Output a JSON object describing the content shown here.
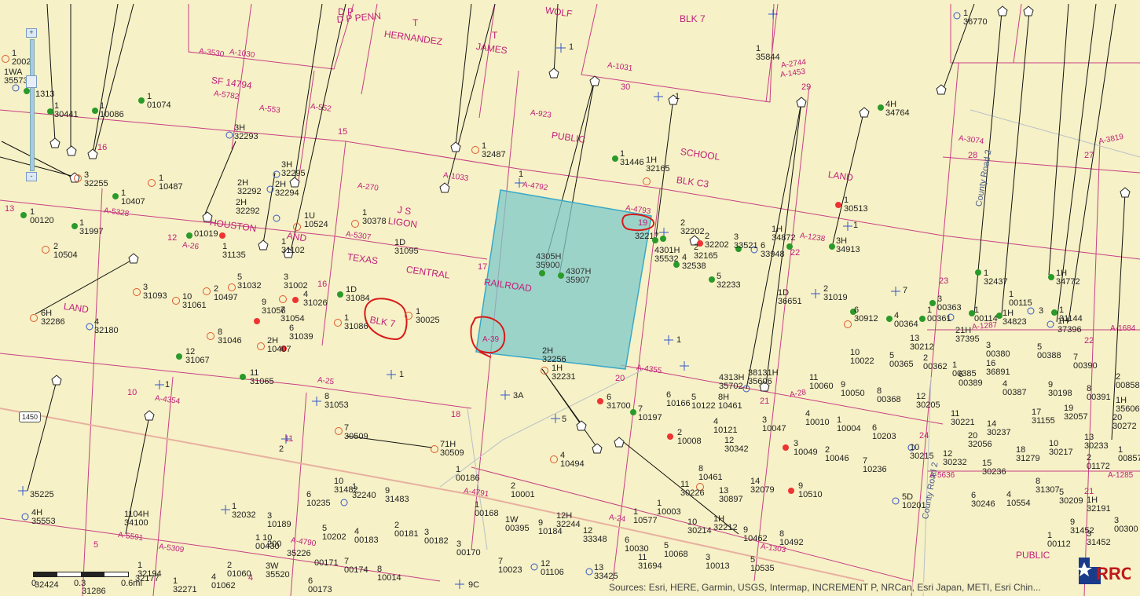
{
  "surveys": [
    {
      "id": "penn",
      "text": "D P\nPENN"
    },
    {
      "id": "hernandez",
      "text": "T\nHERNANDEZ"
    },
    {
      "id": "james",
      "text": "T\nJAMES"
    },
    {
      "id": "wolf",
      "text": "WOLF"
    },
    {
      "id": "blk7top",
      "text": "BLK 7"
    },
    {
      "id": "public1",
      "text": "PUBLIC"
    },
    {
      "id": "school",
      "text": "SCHOOL"
    },
    {
      "id": "blkc3",
      "text": "BLK C3"
    },
    {
      "id": "land1",
      "text": "LAND"
    },
    {
      "id": "houston",
      "text": "HOUSTON"
    },
    {
      "id": "and",
      "text": "AND"
    },
    {
      "id": "texas",
      "text": "TEXAS"
    },
    {
      "id": "central",
      "text": "CENTRAL"
    },
    {
      "id": "railroad",
      "text": "RAILROAD"
    },
    {
      "id": "js",
      "text": "J S"
    },
    {
      "id": "ligon",
      "text": "LIGON"
    },
    {
      "id": "land2",
      "text": "LAND"
    },
    {
      "id": "blk7circ",
      "text": "BLK 7"
    },
    {
      "id": "public2",
      "text": "PUBLIC"
    },
    {
      "id": "sf",
      "text": "SF 14794"
    }
  ],
  "abstracts": [
    "A-1030",
    "A-3530",
    "A-5782",
    "A-553",
    "A-552",
    "A-923",
    "A-1031",
    "A-1033",
    "A-4792",
    "A-270",
    "A-5328",
    "A-5307",
    "A-26",
    "A-4793",
    "A-1238",
    "A-2744",
    "A-1453",
    "A-3819",
    "A-3074",
    "A-1287",
    "A-1684",
    "A-4355",
    "A-28",
    "A-25",
    "A-4354",
    "A-39",
    "A-4791",
    "A-4790",
    "A-5591",
    "A-5309",
    "A-24",
    "A-1303",
    "A-5636",
    "A-1285"
  ],
  "sections": [
    "30",
    "29",
    "15",
    "28",
    "27",
    "13",
    "12",
    "16",
    "11",
    "17",
    "22",
    "23",
    "21",
    "20",
    "19",
    "18",
    "10",
    "14",
    "9",
    "5",
    "4",
    "24",
    "21",
    "22",
    "26",
    "36"
  ],
  "wells": [
    {
      "n": "1\n2002"
    },
    {
      "n": "1WA\n35573"
    },
    {
      "n": "1\n30441"
    },
    {
      "n": "1\n10086"
    },
    {
      "n": "1\n01074"
    },
    {
      "n": "1\n36770"
    },
    {
      "n": "1\n35844"
    },
    {
      "n": "4H\n34764"
    },
    {
      "n": "3H\n32293"
    },
    {
      "n": "3H\n32295"
    },
    {
      "n": "2H\n32294"
    },
    {
      "n": "2H\n32292"
    },
    {
      "n": "2H\n32292"
    },
    {
      "n": "3\n32255"
    },
    {
      "n": "1\n10487"
    },
    {
      "n": "1\n10407"
    },
    {
      "n": "1\n32487"
    },
    {
      "n": "1\n31446"
    },
    {
      "n": "1H\n32165"
    },
    {
      "n": "1\n00120"
    },
    {
      "n": "1\n31997"
    },
    {
      "n": "1\n01019"
    },
    {
      "n": "1U\n10524"
    },
    {
      "n": "1\n30378"
    },
    {
      "n": "1\n31135"
    },
    {
      "n": "1\n31102"
    },
    {
      "n": "1D\n31095"
    },
    {
      "n": "2\n10504"
    },
    {
      "n": "3\n31093"
    },
    {
      "n": "10\n31061"
    },
    {
      "n": "2\n10497"
    },
    {
      "n": "5\n31032"
    },
    {
      "n": "3\n31002"
    },
    {
      "n": "9\n31056"
    },
    {
      "n": "7\n31054"
    },
    {
      "n": "4\n31026"
    },
    {
      "n": "6\n31039"
    },
    {
      "n": "1D\n31084"
    },
    {
      "n": "1\n31086"
    },
    {
      "n": "1\n30025"
    },
    {
      "n": "8\n31046"
    },
    {
      "n": "2H\n10407"
    },
    {
      "n": "6H\n32286"
    },
    {
      "n": "4\n32180"
    },
    {
      "n": "12\n31067"
    },
    {
      "n": "11\n31065"
    },
    {
      "n": "8\n31053"
    },
    {
      "n": "7\n30509"
    },
    {
      "n": "71H\n30509"
    },
    {
      "n": "4305H\n35900"
    },
    {
      "n": "4307H\n35907"
    },
    {
      "n": "2H\n32256"
    },
    {
      "n": "1H\n32231"
    },
    {
      "n": "3A"
    },
    {
      "n": "19\n32217"
    },
    {
      "n": "2\n32202"
    },
    {
      "n": "2\n32202"
    },
    {
      "n": "4301H\n35532"
    },
    {
      "n": "4\n32538"
    },
    {
      "n": "2\n32165"
    },
    {
      "n": "3\n33521"
    },
    {
      "n": "6\n33948"
    },
    {
      "n": "1H\n34872"
    },
    {
      "n": "3H\n34913"
    },
    {
      "n": "5\n32233"
    },
    {
      "n": "1\n30513"
    },
    {
      "n": "1D\n36651"
    },
    {
      "n": "2\n31019"
    },
    {
      "n": "6\n30912"
    },
    {
      "n": "4\n00364"
    },
    {
      "n": "3\n00363"
    },
    {
      "n": "1\n00361"
    },
    {
      "n": "1\n32437"
    },
    {
      "n": "1\n00115"
    },
    {
      "n": "1H\n34823"
    },
    {
      "n": "3"
    },
    {
      "n": "1H\n34772"
    },
    {
      "n": "1\n31144"
    },
    {
      "n": "1H\n37396"
    },
    {
      "n": "21H\n37395"
    },
    {
      "n": "4313H\n35702"
    },
    {
      "n": "4313H\n35606"
    }
  ],
  "attribution": "Sources: Esri, HERE, Garmin, USGS, Intermap, INCREMENT P, NRCan, Esri Japan, METI, Esri Chin...",
  "scale": {
    "left": "0",
    "mid": "0.3",
    "right": "0.6mi"
  },
  "highway": "1450",
  "road": "County Road 2",
  "zoom": {
    "in": "+",
    "out": "-"
  },
  "logo": "RRC",
  "colors": {
    "surveyLine": "#c0207a",
    "selection": "#7ec8c8",
    "annotation": "#d81b1b",
    "background": "#f6f1c6"
  }
}
